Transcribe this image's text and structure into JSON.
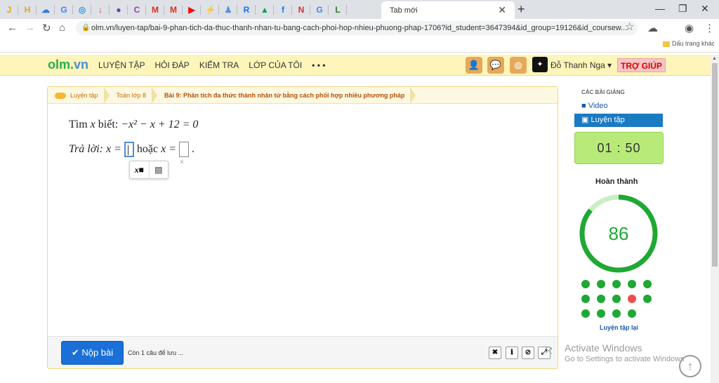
{
  "browser": {
    "active_tab": "Tab mới",
    "url": "olm.vn/luyen-tap/bai-9-phan-tich-da-thuc-thanh-nhan-tu-bang-cach-phoi-hop-nhieu-phuong-phap-1706?id_student=3647394&id_group=19126&id_coursew...",
    "other_bookmarks": "Dấu trang khác",
    "tab_icons": [
      {
        "name": "j-icon",
        "color": "#f4a300",
        "glyph": "J"
      },
      {
        "name": "h-icon",
        "color": "#e8a317",
        "glyph": "H"
      },
      {
        "name": "cloud-icon",
        "color": "#2f7bd8",
        "glyph": "☁"
      },
      {
        "name": "translate-icon",
        "color": "#4285f4",
        "glyph": "G"
      },
      {
        "name": "o-icon",
        "color": "#2b9be0",
        "glyph": "◎"
      },
      {
        "name": "download-icon",
        "color": "#e53935",
        "glyph": "↓"
      },
      {
        "name": "circle-icon",
        "color": "#6b3fb2",
        "glyph": "●"
      },
      {
        "name": "c-icon",
        "color": "#8e44ad",
        "glyph": "C"
      },
      {
        "name": "gmail-icon",
        "color": "#d93025",
        "glyph": "M"
      },
      {
        "name": "gmail-icon-2",
        "color": "#d93025",
        "glyph": "M"
      },
      {
        "name": "youtube-icon",
        "color": "#ff0000",
        "glyph": "▶"
      },
      {
        "name": "bolt-icon",
        "color": "#f4b400",
        "glyph": "⚡"
      },
      {
        "name": "people-icon",
        "color": "#5f8fd8",
        "glyph": "♟"
      },
      {
        "name": "r-icon",
        "color": "#1a73e8",
        "glyph": "R"
      },
      {
        "name": "drive-icon",
        "color": "#0f9d58",
        "glyph": "▲"
      },
      {
        "name": "facebook-icon",
        "color": "#1877f2",
        "glyph": "f"
      },
      {
        "name": "news-icon",
        "color": "#d32f2f",
        "glyph": "N"
      },
      {
        "name": "google-icon",
        "color": "#4285f4",
        "glyph": "G"
      },
      {
        "name": "l-icon",
        "color": "#2e7d32",
        "glyph": "L"
      }
    ]
  },
  "header": {
    "logo_main": "olm",
    "logo_dot": ".",
    "logo_vn": "vn",
    "menu": [
      "LUYỆN TẬP",
      "HỎI ĐÁP",
      "KIỂM TRA",
      "LỚP CỦA TÔI",
      "• • •"
    ],
    "user_name": "Đỗ Thanh Nga",
    "help": "TRỢ GIÚP"
  },
  "breadcrumbs": [
    "Luyện tập",
    "Toán lớp 8",
    "Bài 9: Phân tích đa thức thành nhân tử bằng cách phối hợp nhiều phương pháp"
  ],
  "question": {
    "prefix": "Tìm ",
    "var": "x",
    "mid": " biết: ",
    "equation": "−x² − x + 12 = 0"
  },
  "answer": {
    "label": "Trả lời: ",
    "lhs1": "x =",
    "or": "hoặc",
    "lhs2": "x =",
    "end": "."
  },
  "mathpad": {
    "power": "x■",
    "fraction": "▤"
  },
  "footer": {
    "submit": "✔ Nộp bài",
    "remaining": "Còn 1 câu để lưu ..."
  },
  "sidebar": {
    "title": "CÁC BÀI GIẢNG",
    "video": "Video",
    "practice": "Luyện tập",
    "timer": "01 : 50",
    "done_label": "Hoàn thành",
    "score": "86",
    "progress_percent": 86,
    "redo": "Luyện tập lại",
    "dots": [
      "green",
      "green",
      "green",
      "green",
      "green",
      "green",
      "green",
      "green",
      "red",
      "green",
      "green",
      "green",
      "green",
      "green"
    ],
    "colors": {
      "green": "#1fa834",
      "red": "#f04c4c",
      "ring": "#1fa834",
      "ring_bg": "#c9efc3"
    }
  },
  "windows": {
    "activate_title": "Activate Windows",
    "activate_sub": "Go to Settings to activate Windows"
  }
}
